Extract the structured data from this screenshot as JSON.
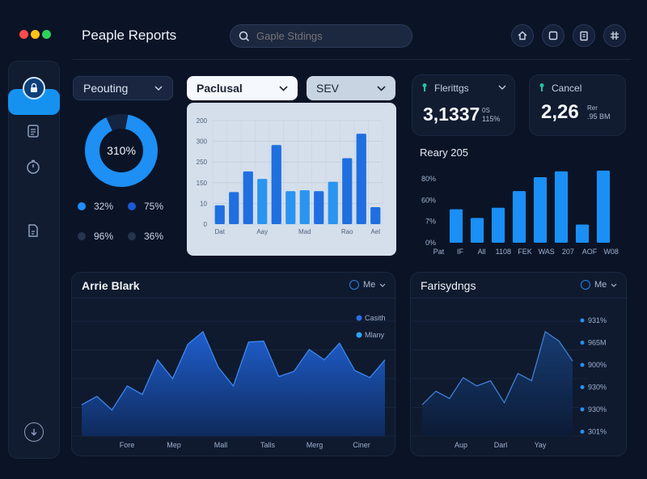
{
  "window": {
    "title": "Peaple Reports",
    "dots": [
      "#ff4b4b",
      "#ffc21a",
      "#2fd15a"
    ]
  },
  "search": {
    "placeholder": "Gaple Stdings"
  },
  "toolbar": {
    "icons": [
      "home-icon",
      "window-icon",
      "clipboard-icon",
      "grid-icon"
    ]
  },
  "sidebar": {
    "items": [
      "lock-icon",
      "document-icon",
      "timer-icon",
      "file-icon"
    ],
    "footer_icon": "download-icon"
  },
  "filters": {
    "left_dropdown": "Peouting",
    "middle_dropdown": "Paclusal",
    "right_dropdown": "SEV"
  },
  "donut": {
    "center_label": "310%",
    "fraction": 0.9,
    "legend": [
      {
        "label": "32%",
        "color": "#1f8fff"
      },
      {
        "label": "75%",
        "color": "#1a5ad6"
      },
      {
        "label": "96%",
        "color": "#27344f"
      },
      {
        "label": "36%",
        "color": "#27344f"
      }
    ]
  },
  "kpis": [
    {
      "title": "Flerittgs",
      "value": "3,1337",
      "sub1": "0S",
      "sub2": "115%"
    },
    {
      "title": "Cancel",
      "value": "2,26",
      "sub1": "Rer",
      "sub2": ".95 BM"
    }
  ],
  "chart_data": [
    {
      "type": "bar",
      "categories": [
        "Dat",
        "",
        "",
        "Aay",
        "",
        "",
        "Mad",
        "",
        "",
        "Rao",
        "",
        "Ael"
      ],
      "y_ticks": [
        "200",
        "300",
        "250",
        "150",
        "10",
        "0"
      ],
      "values": [
        20,
        34,
        56,
        48,
        84,
        35,
        36,
        35,
        45,
        70,
        96,
        18
      ],
      "colors": [
        "#1f6fe0",
        "#1f6fe0",
        "#1f6fe0",
        "#2a94f0",
        "#1f6fe0",
        "#2a94f0",
        "#2a94f0",
        "#1f6fe0",
        "#2a94f0",
        "#1f6fe0",
        "#1f6fe0",
        "#1f6fe0"
      ],
      "ylim": [
        0,
        110
      ],
      "grid": true
    },
    {
      "type": "bar",
      "title": "Reary 205",
      "categories": [
        "Pat",
        "IF",
        "All",
        "1108",
        "FEK",
        "WAS",
        "207",
        "AOF",
        "W08"
      ],
      "y_ticks": [
        "80%",
        "60%",
        "7%",
        "0%"
      ],
      "values": [
        46,
        34,
        48,
        71,
        90,
        98,
        25,
        99
      ],
      "ylim": [
        0,
        110
      ],
      "grid": false
    },
    {
      "type": "area",
      "title": "Arrie Blark",
      "dropdown": "Me",
      "categories": [
        "Fore",
        "Mep",
        "Mall",
        "Talls",
        "Merg",
        "Ciner"
      ],
      "legend": [
        {
          "name": "Casith",
          "color": "#2a6fe0"
        },
        {
          "name": "Mlany",
          "color": "#2aa8f5"
        }
      ],
      "values": [
        30,
        38,
        25,
        48,
        40,
        73,
        55,
        88,
        100,
        66,
        48,
        90,
        91,
        57,
        62,
        83,
        73,
        89,
        63,
        56,
        73
      ],
      "ylim": [
        0,
        110
      ]
    },
    {
      "type": "area",
      "title": "Farisydngs",
      "dropdown": "Me",
      "categories": [
        "Aup",
        "Darl",
        "Yay"
      ],
      "y_ticks": [
        "931%",
        "965M",
        "900%",
        "930%",
        "930%",
        "301%"
      ],
      "values": [
        30,
        43,
        36,
        56,
        48,
        53,
        32,
        60,
        53,
        100,
        91,
        72
      ],
      "ylim": [
        0,
        110
      ]
    }
  ]
}
